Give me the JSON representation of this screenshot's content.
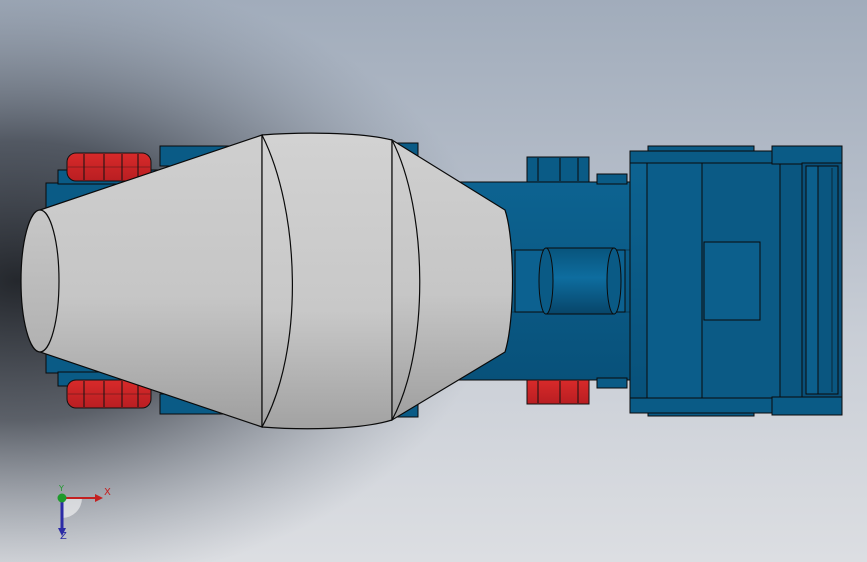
{
  "viewport": {
    "background_top": "#a1acbb",
    "background_bottom": "#dcdee2",
    "shadow_color": "#1c1f24"
  },
  "model": {
    "chassis_color": "#0b5a84",
    "chassis_dark": "#063c5a",
    "drum_color": "#cfcfcf",
    "drum_shade": "#a9a9a9",
    "wheel_color": "#d8262a",
    "edge_color": "#0a0a0a"
  },
  "triad": {
    "x_label": "X",
    "y_label": "Y",
    "z_label": "Z",
    "x_color": "#c42020",
    "y_color": "#1e9a2c",
    "z_color": "#2b2ba6"
  }
}
